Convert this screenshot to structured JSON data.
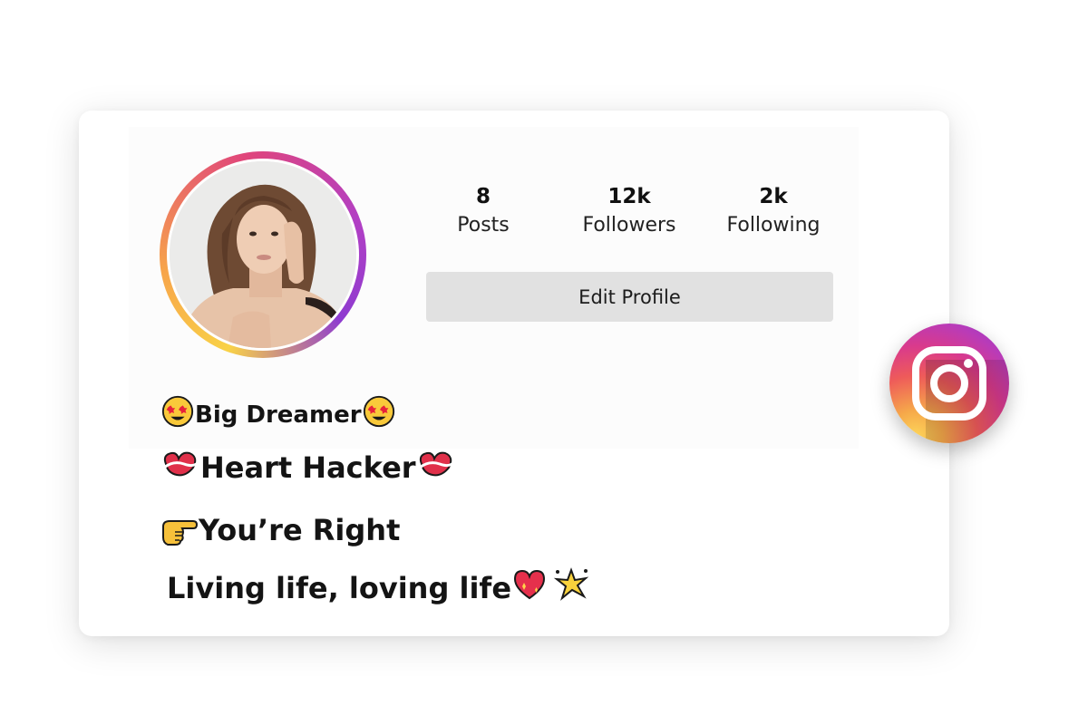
{
  "profile": {
    "stats": [
      {
        "value": "8",
        "label": "Posts"
      },
      {
        "value": "12k",
        "label": "Followers"
      },
      {
        "value": "2k",
        "label": "Following"
      }
    ],
    "edit_button_label": "Edit Profile"
  },
  "bio": {
    "line1_text": "Big Dreamer ",
    "line2_text": "Heart Hacker",
    "line3_text": "You’re Right",
    "line4_text": "Living life, loving life "
  },
  "icons": {
    "line1_prefix": "star-struck-emoji-icon",
    "line1_suffix": "star-struck-emoji-icon",
    "line2_prefix": "love-letter-heart-emoji-icon",
    "line2_suffix": "love-letter-heart-emoji-icon",
    "line3_prefix": "pointing-hand-emoji-icon",
    "line4_heart": "sparkling-heart-emoji-icon",
    "line4_sparkle": "sparkle-star-emoji-icon",
    "badge": "instagram-icon"
  },
  "colors": {
    "button_bg": "#e1e1e1",
    "ring_gradient": [
      "#f9d247",
      "#e0457b",
      "#8e3bd0"
    ],
    "badge_gradient": [
      "#fdd65a",
      "#ee5a5a",
      "#8b3cd0"
    ]
  }
}
